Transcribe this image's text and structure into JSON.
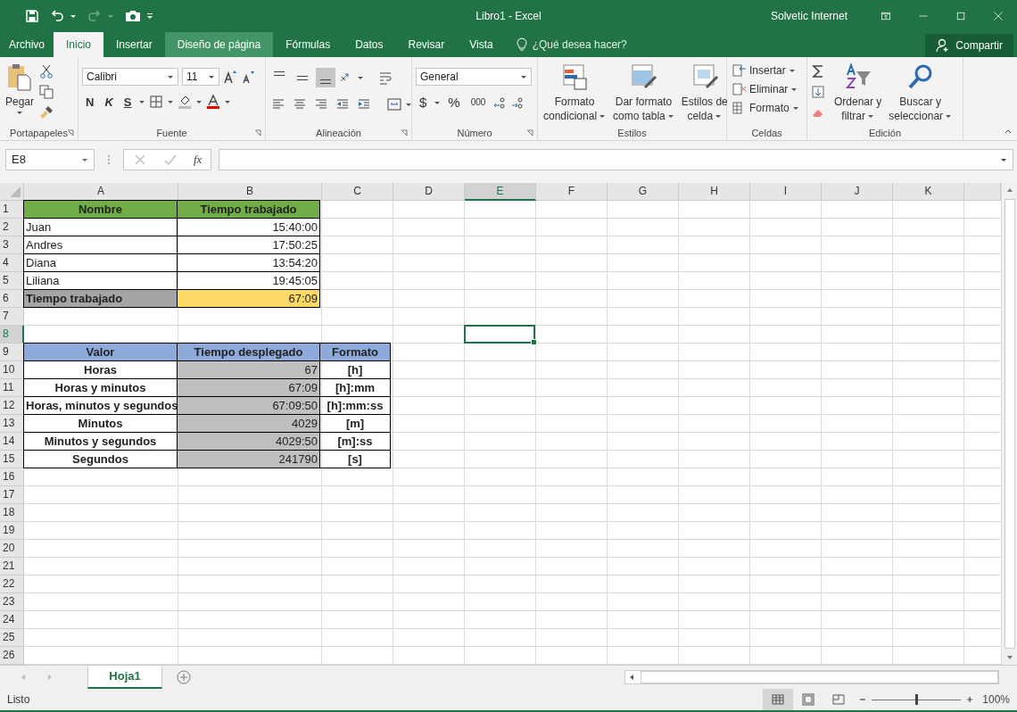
{
  "title_bar": {
    "title": "Libro1  -  Excel",
    "user": "Solvetic Internet"
  },
  "menu_tabs": [
    {
      "label": "Archivo",
      "selected": false,
      "hovered": false
    },
    {
      "label": "Inicio",
      "selected": true,
      "hovered": false
    },
    {
      "label": "Insertar",
      "selected": false,
      "hovered": false
    },
    {
      "label": "Diseño de página",
      "selected": false,
      "hovered": true
    },
    {
      "label": "Fórmulas",
      "selected": false,
      "hovered": false
    },
    {
      "label": "Datos",
      "selected": false,
      "hovered": false
    },
    {
      "label": "Revisar",
      "selected": false,
      "hovered": false
    },
    {
      "label": "Vista",
      "selected": false,
      "hovered": false
    }
  ],
  "tell_me": {
    "placeholder": "¿Qué desea hacer?"
  },
  "share_button": "Compartir",
  "ribbon": {
    "clipboard": {
      "label": "Portapapeles",
      "paste": "Pegar"
    },
    "font": {
      "label": "Fuente",
      "font_name": "Calibri",
      "font_size": "11",
      "bold": "N",
      "italic": "K",
      "underline": "S"
    },
    "alignment": {
      "label": "Alineación",
      "vertical": [
        {
          "kind": "top",
          "selected": false
        },
        {
          "kind": "middle",
          "selected": false
        },
        {
          "kind": "bottom",
          "selected": true
        }
      ]
    },
    "number": {
      "label": "Número",
      "format": "General",
      "currency": "$",
      "percent": "%",
      "thousands": "000"
    },
    "styles": {
      "label": "Estilos",
      "buttons": [
        {
          "kind": "conditional",
          "line1": "Formato",
          "line2": "condicional"
        },
        {
          "kind": "table",
          "line1": "Dar formato",
          "line2": "como tabla"
        },
        {
          "kind": "cell",
          "line1": "Estilos de",
          "line2": "celda"
        }
      ]
    },
    "cells": {
      "label": "Celdas",
      "buttons": [
        {
          "kind": "insert",
          "label": "Insertar"
        },
        {
          "kind": "delete",
          "label": "Eliminar"
        },
        {
          "kind": "format",
          "label": "Formato"
        }
      ]
    },
    "editing": {
      "label": "Edición",
      "buttons": [
        {
          "kind": "sort",
          "line1": "Ordenar y",
          "line2": "filtrar"
        },
        {
          "kind": "find",
          "line1": "Buscar y",
          "line2": "seleccionar"
        }
      ]
    }
  },
  "formula_bar": {
    "name_box": "E8",
    "function_label": "fx"
  },
  "sheet": {
    "columns": [
      {
        "label": "A",
        "selected": false
      },
      {
        "label": "B",
        "selected": false
      },
      {
        "label": "C",
        "selected": false
      },
      {
        "label": "D",
        "selected": false
      },
      {
        "label": "E",
        "selected": true
      },
      {
        "label": "F",
        "selected": false
      },
      {
        "label": "G",
        "selected": false
      },
      {
        "label": "H",
        "selected": false
      },
      {
        "label": "I",
        "selected": false
      },
      {
        "label": "J",
        "selected": false
      },
      {
        "label": "K",
        "selected": false
      }
    ],
    "rows": [
      {
        "number": "1",
        "selected": false,
        "cells": [
          {
            "text": "Nombre",
            "kind": "green_header"
          },
          {
            "text": "Tiempo trabajado",
            "kind": "green_header"
          }
        ]
      },
      {
        "number": "2",
        "selected": false,
        "cells": [
          {
            "text": "Juan",
            "kind": "name"
          },
          {
            "text": "15:40:00",
            "kind": "time"
          }
        ]
      },
      {
        "number": "3",
        "selected": false,
        "cells": [
          {
            "text": "Andres",
            "kind": "name"
          },
          {
            "text": "17:50:25",
            "kind": "time"
          }
        ]
      },
      {
        "number": "4",
        "selected": false,
        "cells": [
          {
            "text": "Diana",
            "kind": "name"
          },
          {
            "text": "13:54:20",
            "kind": "time"
          }
        ]
      },
      {
        "number": "5",
        "selected": false,
        "cells": [
          {
            "text": "Liliana",
            "kind": "name"
          },
          {
            "text": "19:45:05",
            "kind": "time"
          }
        ]
      },
      {
        "number": "6",
        "selected": false,
        "cells": [
          {
            "text": "Tiempo trabajado",
            "kind": "total_label"
          },
          {
            "text": "67:09",
            "kind": "total_value"
          }
        ]
      },
      {
        "number": "7",
        "selected": false
      },
      {
        "number": "8",
        "selected": true
      },
      {
        "number": "9",
        "selected": false,
        "cells": [
          {
            "text": "Valor",
            "kind": "blue_header"
          },
          {
            "text": "Tiempo desplegado",
            "kind": "blue_header"
          },
          {
            "text": "Formato",
            "kind": "blue_header"
          }
        ]
      },
      {
        "number": "10",
        "selected": false,
        "cells": [
          {
            "text": "Horas",
            "kind": "label"
          },
          {
            "text": "67",
            "kind": "gray_value"
          },
          {
            "text": "[h]",
            "kind": "format"
          }
        ]
      },
      {
        "number": "11",
        "selected": false,
        "cells": [
          {
            "text": "Horas y minutos",
            "kind": "label"
          },
          {
            "text": "67:09",
            "kind": "gray_value"
          },
          {
            "text": "[h]:mm",
            "kind": "format"
          }
        ]
      },
      {
        "number": "12",
        "selected": false,
        "cells": [
          {
            "text": "Horas, minutos y segundos",
            "kind": "label"
          },
          {
            "text": "67:09:50",
            "kind": "gray_value"
          },
          {
            "text": "[h]:mm:ss",
            "kind": "format"
          }
        ]
      },
      {
        "number": "13",
        "selected": false,
        "cells": [
          {
            "text": "Minutos",
            "kind": "label"
          },
          {
            "text": "4029",
            "kind": "gray_value"
          },
          {
            "text": "[m]",
            "kind": "format"
          }
        ]
      },
      {
        "number": "14",
        "selected": false,
        "cells": [
          {
            "text": "Minutos y segundos",
            "kind": "label"
          },
          {
            "text": "4029:50",
            "kind": "gray_value"
          },
          {
            "text": "[m]:ss",
            "kind": "format"
          }
        ]
      },
      {
        "number": "15",
        "selected": false,
        "cells": [
          {
            "text": "Segundos",
            "kind": "label"
          },
          {
            "text": "241790",
            "kind": "gray_value"
          },
          {
            "text": "[s]",
            "kind": "format"
          }
        ]
      },
      {
        "number": "16",
        "selected": false
      },
      {
        "number": "17",
        "selected": false
      },
      {
        "number": "18",
        "selected": false
      },
      {
        "number": "19",
        "selected": false
      },
      {
        "number": "20",
        "selected": false
      },
      {
        "number": "21",
        "selected": false
      },
      {
        "number": "22",
        "selected": false
      },
      {
        "number": "23",
        "selected": false
      },
      {
        "number": "24",
        "selected": false
      },
      {
        "number": "25",
        "selected": false
      },
      {
        "number": "26",
        "selected": false
      }
    ]
  },
  "sheet_tabs": [
    {
      "label": "Hoja1",
      "selected": true
    }
  ],
  "status_bar": {
    "status": "Listo",
    "views": [
      {
        "kind": "normal",
        "selected": true
      },
      {
        "kind": "page_layout",
        "selected": false
      },
      {
        "kind": "page_break",
        "selected": false
      }
    ],
    "zoom_slider": {
      "level": 0.5
    },
    "zoom": "100%"
  }
}
